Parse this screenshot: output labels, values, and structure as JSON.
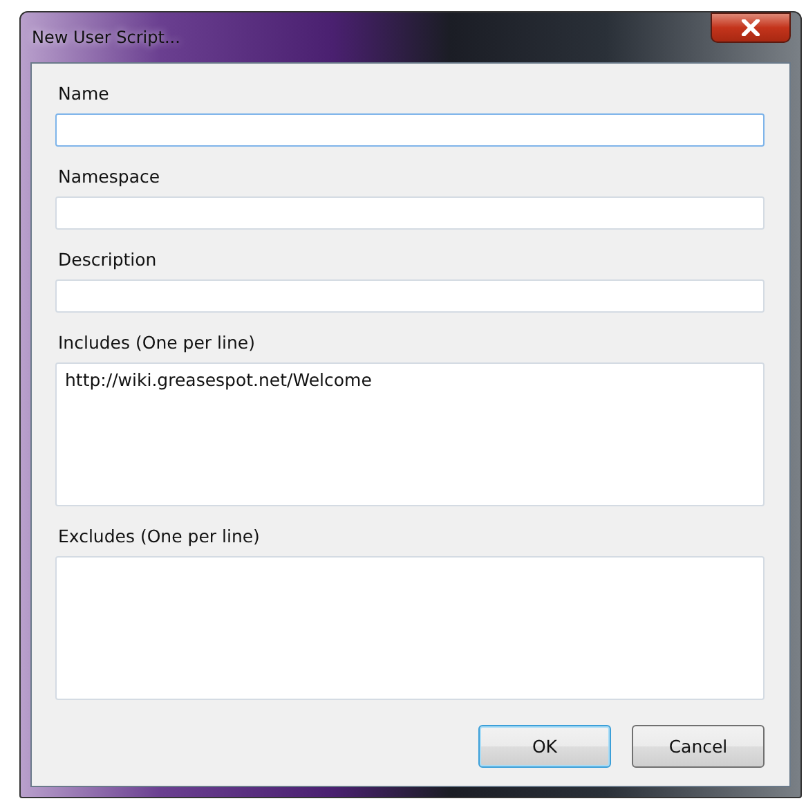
{
  "window": {
    "title": "New User Script..."
  },
  "fields": [
    {
      "label": "Name",
      "kind": "line",
      "focused": true
    },
    {
      "label": "Namespace",
      "kind": "line",
      "focused": false
    },
    {
      "label": "Description",
      "kind": "line",
      "focused": false
    },
    {
      "label": "Includes (One per line)",
      "kind": "area",
      "value": "http://wiki.greasespot.net/Welcome",
      "focused": false
    },
    {
      "label": "Excludes (One per line)",
      "kind": "area",
      "focused": false
    }
  ],
  "buttons": [
    {
      "label": "OK",
      "default": true
    },
    {
      "label": "Cancel",
      "default": false
    }
  ]
}
